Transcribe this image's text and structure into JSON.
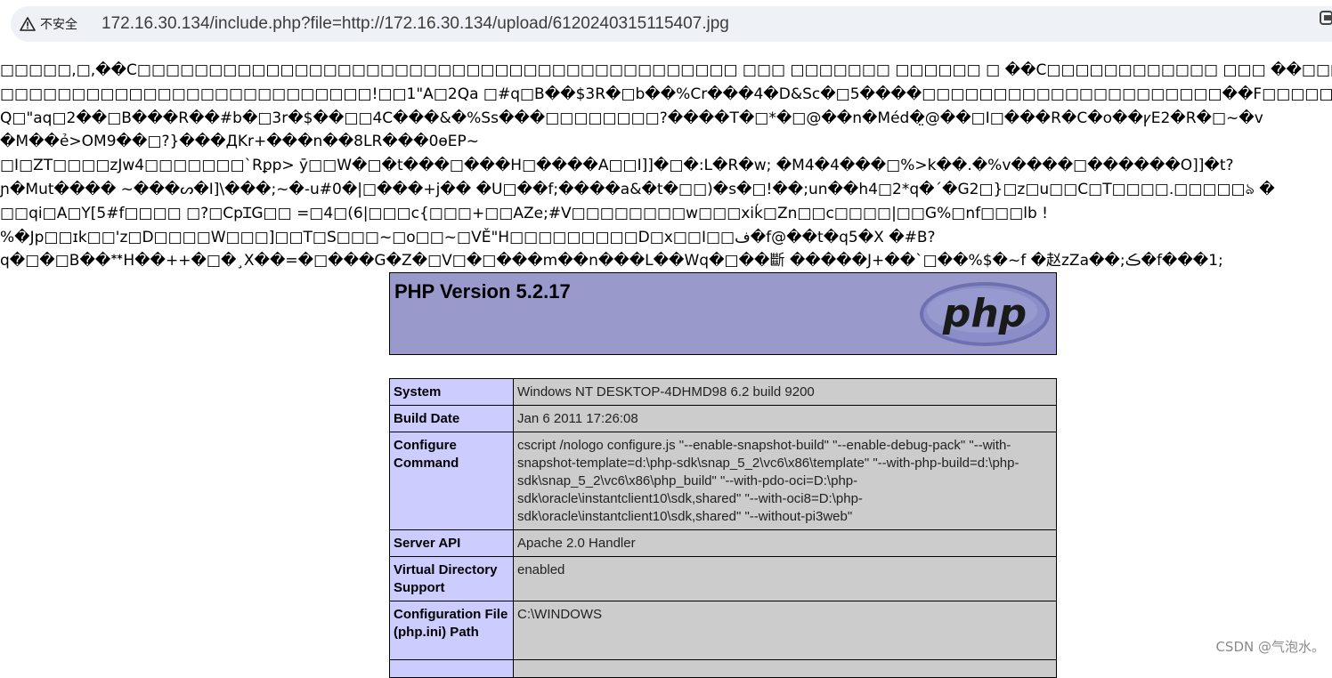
{
  "browser": {
    "security_label": "不安全",
    "url": "172.16.30.134/include.php?file=http://172.16.30.134/upload/6120240315115407.jpg"
  },
  "garbage_lines": [
    "□□□□□,□,��C□□□□□□□□□□□□□□□□□□□□□□□□□□□□□□□□□□□□□□□□□□ □□□ □□□□□□□ □□□□□□ □ ��C□□□□□□□□□□□□ □□□ ��□□□'□□□□□□□□□□□□□�□□□□□□□",
    "□□□□□□□□□□□□□□□□□□□□□□□□□□!□□1\"A□2Qa □#q□B��$3R�□b��%Cr���4�D&Sc�□5����□□□□□□□□□□□□□□□□□□□□□��F□□□□□□□□□□□□□□□",
    "Q□\"aq□2��□B���R��#b�□3r�$��□□4C���&�%Ss���□□□□□□□□?����T�□*�□@��n�Méd�̤@��□I□���R�C�o��ꝩE2�R�□~�v",
    " �M��ẻ>OM9��□?}���ДKr+���n��8LR���0ɵEP~",
    "□I□ZT□□□□zJw4□□□□□□□`Rꝑp> ȳ□□W�□�t���□���H□����A□□I]]�□�:L�R�w; �M4�4���□%>k��.�%v����□������O]]�t?",
    "ɲ�Mut���� ~���ᔕ�I]\\���;~�-u#0�|□���+j�� �U□��f;����a&�t�□□)�s�□!��;un��h4□2*q�´�G2□}□z□u□□C□T□□□□.□□□□□ঌ �",
    "□□qi□A□Y[5#f□□□□ □?□CpꞮG□□ =□4□(6|□□□c{□□□+□□AZe;#V□□□□□□□□w□□□xiḱ□Zn□□c□□□□|□□G%□nf□□□lb !",
    "%�Jp□□ɪk□□'z□D□□□□W□□□]□□T□S□□□~□o□□~□VĚ\"H□□□□□□□□□D□x□□I□□ف�f@��t�q5�X �#B?",
    "q�□�□B��ᕯH��++�□�¸X��=�□���G�Z�□V□�□���m��n���L��Wq�□��斷 �����J+��`□��%$�~f �赵zZa��;ڪ�f���1;"
  ],
  "php": {
    "version_title": "PHP Version 5.2.17",
    "logo_text": "php",
    "rows": [
      {
        "key": "System",
        "value": "Windows NT DESKTOP-4DHMD98 6.2 build 9200"
      },
      {
        "key": "Build Date",
        "value": "Jan 6 2011 17:26:08"
      },
      {
        "key": "Configure Command",
        "value": "cscript /nologo configure.js \"--enable-snapshot-build\" \"--enable-debug-pack\" \"--with-snapshot-template=d:\\php-sdk\\snap_5_2\\vc6\\x86\\template\" \"--with-php-build=d:\\php-sdk\\snap_5_2\\vc6\\x86\\php_build\" \"--with-pdo-oci=D:\\php-sdk\\oracle\\instantclient10\\sdk,shared\" \"--with-oci8=D:\\php-sdk\\oracle\\instantclient10\\sdk,shared\" \"--without-pi3web\""
      },
      {
        "key": "Server API",
        "value": "Apache 2.0 Handler"
      },
      {
        "key": "Virtual Directory Support",
        "value": "enabled"
      },
      {
        "key": "Configuration File (php.ini) Path",
        "value": "C:\\WINDOWS"
      },
      {
        "key": "",
        "value": ""
      }
    ]
  },
  "watermark": "CSDN @气泡水。",
  "colors": {
    "php_header_bg": "#9999cc",
    "php_key_bg": "#ccccff",
    "php_value_bg": "#cccccc",
    "url_bar_bg": "#eef1f6"
  },
  "icons": [
    "warning-triangle-icon",
    "browser-extension-icon",
    "php-logo"
  ]
}
